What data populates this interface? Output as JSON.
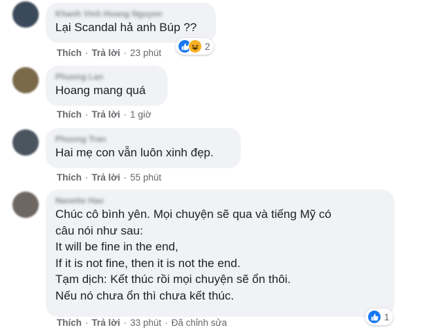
{
  "comments": [
    {
      "lines": [
        "Lại Scandal hả anh Búp ??"
      ],
      "like": "Thích",
      "reply": "Trả lời",
      "time": "23 phút",
      "edited": "",
      "reaction_count": "2",
      "avatar_color": "#3b4a5a"
    },
    {
      "lines": [
        "Hoang mang quá"
      ],
      "like": "Thích",
      "reply": "Trả lời",
      "time": "1 giờ",
      "edited": "",
      "reaction_count": "",
      "avatar_color": "#7a6a4a"
    },
    {
      "lines": [
        "Hai mẹ con vẫn luôn xinh đẹp."
      ],
      "like": "Thích",
      "reply": "Trả lời",
      "time": "55 phút",
      "edited": "",
      "reaction_count": "",
      "avatar_color": "#4a5560"
    },
    {
      "lines": [
        "Chúc cô bình yên. Mọi chuyện sẽ qua và tiếng Mỹ có",
        "câu nói như sau:",
        "It will be fine in the end,",
        "If it is not fine, then it is not the end.",
        "Tạm dịch: Kết thúc rồi mọi chuyện sẽ ổn thôi.",
        "Nếu nó chưa ổn thì chưa kết thúc."
      ],
      "like": "Thích",
      "reply": "Trả lời",
      "time": "33 phút",
      "edited": "Đã chỉnh sửa",
      "reaction_count": "1",
      "avatar_color": "#6e6660"
    }
  ],
  "reaction_icons": [
    "like-icon",
    "haha-icon"
  ],
  "colors": {
    "like": "#1877f2",
    "haha": "#f7b125",
    "bubble": "#f0f2f5",
    "meta": "#65676b"
  }
}
